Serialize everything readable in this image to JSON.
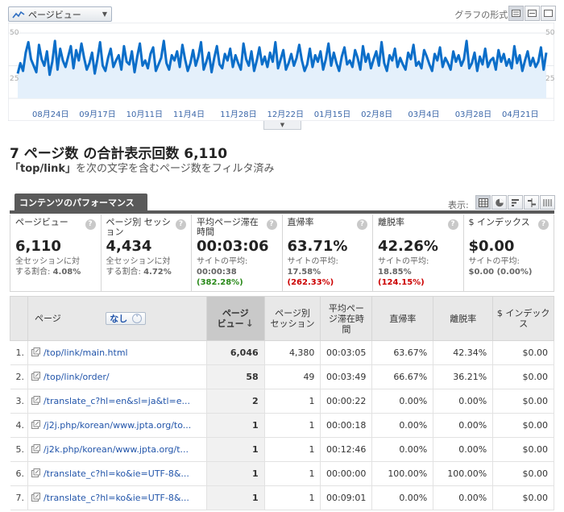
{
  "header": {
    "metric_selector": "ページビュー",
    "graph_format_label": "グラフの形式:"
  },
  "chart": {
    "y_labels": [
      "50",
      "25"
    ],
    "x_labels": [
      "08月24日",
      "09月17日",
      "10月11日",
      "11月4日",
      "11月28日",
      "12月22日",
      "01月15日",
      "02月8日",
      "03月4日",
      "03月28日",
      "04月21日"
    ],
    "line_color": "#0b6ec9",
    "fill_color": "#e4f0fb"
  },
  "chart_data": {
    "type": "area",
    "ylim": [
      0,
      50
    ],
    "x_tick_labels": [
      "08月24日",
      "09月17日",
      "10月11日",
      "11月4日",
      "11月28日",
      "12月22日",
      "01月15日",
      "02月8日",
      "03月4日",
      "03月28日",
      "04月21日"
    ],
    "values": [
      19,
      27,
      21,
      35,
      43,
      30,
      25,
      20,
      41,
      30,
      25,
      36,
      18,
      28,
      44,
      22,
      38,
      29,
      24,
      32,
      40,
      23,
      37,
      29,
      42,
      31,
      22,
      27,
      35,
      19,
      30,
      43,
      25,
      21,
      31,
      38,
      24,
      29,
      33,
      22,
      40,
      28,
      26,
      36,
      20,
      32,
      42,
      25,
      29,
      23,
      34,
      39,
      21,
      26,
      31,
      44,
      27,
      22,
      33,
      29,
      36,
      24,
      41,
      30,
      21,
      27,
      37,
      25,
      32,
      43,
      22,
      28,
      35,
      20,
      31,
      40,
      26,
      23,
      34,
      29,
      38,
      24,
      33,
      27,
      22,
      42,
      30,
      25,
      36,
      21,
      29,
      39,
      26,
      32,
      24,
      35,
      28,
      43,
      23,
      30,
      37,
      22,
      27,
      34,
      25,
      31,
      41,
      29,
      21,
      26,
      38,
      24,
      33,
      28,
      36,
      22,
      30,
      42,
      25,
      35,
      27,
      21,
      32,
      39,
      26,
      29,
      24,
      37,
      31,
      22,
      40,
      28,
      34,
      23,
      30,
      36,
      25,
      43,
      27,
      21,
      33,
      29,
      38,
      24,
      31,
      26,
      22,
      35,
      30,
      41,
      25,
      28,
      23,
      37,
      32,
      26,
      21,
      34,
      29,
      39,
      24,
      31,
      27,
      22,
      36,
      28,
      33,
      25,
      30,
      44,
      23,
      27,
      35,
      21,
      32,
      26,
      38,
      24,
      29,
      31,
      22,
      37,
      28,
      34,
      25,
      30,
      23,
      40,
      27,
      33,
      21,
      29,
      36,
      25,
      31,
      24,
      28,
      39,
      22,
      35
    ]
  },
  "summary": {
    "page_count": "7 ページ数",
    "total_label": "の合計表示回数",
    "total_value": "6,110"
  },
  "filter": {
    "keyword": "「top/link」",
    "rest": "を次の文字を含むページ数をフィルタ済み"
  },
  "tab": {
    "label": "コンテンツのパフォーマンス"
  },
  "display_label": "表示:",
  "scorecards": [
    {
      "title": "ページビュー",
      "value": "6,110",
      "sub1": "全セッションに対",
      "sub2a": "する割合: ",
      "sub2b": "4.08%",
      "sub2c": "",
      "style": "plain"
    },
    {
      "title": "ページ別 セッション",
      "value": "4,434",
      "sub1": "全セッションに対",
      "sub2a": "する割合: ",
      "sub2b": "4.72%",
      "sub2c": "",
      "style": "plain"
    },
    {
      "title": "平均ページ滞在時間",
      "value": "00:03:06",
      "sub1": "サイトの平均:",
      "sub2a": "",
      "sub2b": "00:00:38",
      "sub2c": " (382.28%)",
      "style": "green"
    },
    {
      "title": "直帰率",
      "value": "63.71%",
      "sub1": "サイトの平均:",
      "sub2a": "",
      "sub2b": "17.58%",
      "sub2c": " (262.33%)",
      "style": "red"
    },
    {
      "title": "離脱率",
      "value": "42.26%",
      "sub1": "サイトの平均:",
      "sub2a": "",
      "sub2b": "18.85%",
      "sub2c": " (124.15%)",
      "style": "red"
    },
    {
      "title": "$ インデックス",
      "value": "$0.00",
      "sub1": "サイトの平均:",
      "sub2a": "",
      "sub2b": "$0.00 (0.00%)",
      "sub2c": "",
      "style": "plain"
    }
  ],
  "table": {
    "headers": {
      "page": "ページ",
      "dimension": "なし",
      "pageviews_1": "ページ",
      "pageviews_2": "ビュー",
      "sessions_1": "ページ別",
      "sessions_2": "セッション",
      "time_1": "平均ペー",
      "time_2": "ジ滞在時",
      "time_3": "間",
      "bounce": "直帰率",
      "exit": "離脱率",
      "index": "$ インデックス"
    },
    "rows": [
      {
        "idx": "1.",
        "page": "/top/link/main.html",
        "pv": "6,046",
        "sess": "4,380",
        "time": "00:03:05",
        "bounce": "63.67%",
        "exit": "42.34%",
        "index": "$0.00"
      },
      {
        "idx": "2.",
        "page": "/top/link/order/",
        "pv": "58",
        "sess": "49",
        "time": "00:03:49",
        "bounce": "66.67%",
        "exit": "36.21%",
        "index": "$0.00"
      },
      {
        "idx": "3.",
        "page": "/translate_c?hl=en&sl=ja&tl=e...",
        "pv": "2",
        "sess": "1",
        "time": "00:00:22",
        "bounce": "0.00%",
        "exit": "0.00%",
        "index": "$0.00"
      },
      {
        "idx": "4.",
        "page": "/j2j.php/korean/www.jpta.org/to...",
        "pv": "1",
        "sess": "1",
        "time": "00:00:18",
        "bounce": "0.00%",
        "exit": "0.00%",
        "index": "$0.00"
      },
      {
        "idx": "5.",
        "page": "/j2k.php/korean/www.jpta.org/t...",
        "pv": "1",
        "sess": "1",
        "time": "00:12:46",
        "bounce": "0.00%",
        "exit": "0.00%",
        "index": "$0.00"
      },
      {
        "idx": "6.",
        "page": "/translate_c?hl=ko&ie=UTF-8&...",
        "pv": "1",
        "sess": "1",
        "time": "00:00:00",
        "bounce": "100.00%",
        "exit": "100.00%",
        "index": "$0.00"
      },
      {
        "idx": "7.",
        "page": "/translate_c?hl=ko&ie=UTF-8&...",
        "pv": "1",
        "sess": "1",
        "time": "00:09:01",
        "bounce": "0.00%",
        "exit": "0.00%",
        "index": "$0.00"
      }
    ]
  }
}
